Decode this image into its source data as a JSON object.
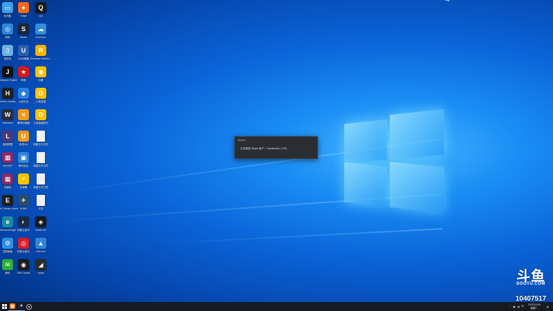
{
  "desktop": {
    "icons": [
      {
        "label": "此电脑",
        "color": "#3aa0e8",
        "glyph": "▭"
      },
      {
        "label": "Origin",
        "color": "#f06a1c",
        "glyph": "●"
      },
      {
        "label": "QQ",
        "color": "#1a1a1a",
        "glyph": "Q"
      },
      {
        "label": "网络",
        "color": "#2f86d6",
        "glyph": "◎"
      },
      {
        "label": "Steam",
        "color": "#1b2838",
        "glyph": "S"
      },
      {
        "label": "OneDrive",
        "color": "#2f8fe0",
        "glyph": "☁"
      },
      {
        "label": "回收站",
        "color": "#6ab0e6",
        "glyph": "▯"
      },
      {
        "label": "UU加速器",
        "color": "#2a5fb0",
        "glyph": "U"
      },
      {
        "label": "Rockstar Games Launcher",
        "color": "#f2b400",
        "glyph": "R"
      },
      {
        "label": "Wallpaper Engine",
        "color": "#111111",
        "glyph": "J"
      },
      {
        "label": "网易",
        "color": "#d11a1a",
        "glyph": "★"
      },
      {
        "label": "迅雷",
        "color": "#f2c200",
        "glyph": "◉"
      },
      {
        "label": "Heroic Games",
        "color": "#1f1f1f",
        "glyph": "H"
      },
      {
        "label": "火绒安全",
        "color": "#2a7fe0",
        "glyph": "◆"
      },
      {
        "label": "斗鱼直播",
        "color": "#f5c400",
        "glyph": "D"
      },
      {
        "label": "WeGame",
        "color": "#2b2b3a",
        "glyph": "W"
      },
      {
        "label": "雷神加速器",
        "color": "#f29a1a",
        "glyph": "✕"
      },
      {
        "label": "斗鱼直播伴侣",
        "color": "#f5c400",
        "glyph": "D"
      },
      {
        "label": "英雄联盟",
        "color": "#4b3a7a",
        "glyph": "L"
      },
      {
        "label": "网易UU",
        "color": "#f29a1a",
        "glyph": "U"
      },
      {
        "label": "新建文本文档",
        "color": "#f0f0f0",
        "glyph": ""
      },
      {
        "label": "WinRAR",
        "color": "#8a2a6a",
        "glyph": "▦"
      },
      {
        "label": "腾讯会议",
        "color": "#2f86d6",
        "glyph": "▣"
      },
      {
        "label": "新建文本文档",
        "color": "#f0f0f0",
        "glyph": ""
      },
      {
        "label": "压缩包",
        "color": "#8a2a6a",
        "glyph": "▦"
      },
      {
        "label": "加速器",
        "color": "#f5c400",
        "glyph": "⚡"
      },
      {
        "label": "新建文本文档",
        "color": "#f0f0f0",
        "glyph": ""
      },
      {
        "label": "Epic Games Launcher",
        "color": "#1f1f1f",
        "glyph": "E"
      },
      {
        "label": "PUBG",
        "color": "#2a4a6a",
        "glyph": "✈"
      },
      {
        "label": "文档",
        "color": "#f0f0f0",
        "glyph": ""
      },
      {
        "label": "Microsoft Edge",
        "color": "#1a8a9e",
        "glyph": "e"
      },
      {
        "label": "网易云音乐",
        "color": "#1a2a4a",
        "glyph": "◐"
      },
      {
        "label": "Battle.net",
        "color": "#1a1a1a",
        "glyph": "◈"
      },
      {
        "label": "控制面板",
        "color": "#2f8fe0",
        "glyph": "⚙"
      },
      {
        "label": "网易云音乐",
        "color": "#d81e2c",
        "glyph": "◎"
      },
      {
        "label": "GeForce",
        "color": "#2f86d6",
        "glyph": "▲"
      },
      {
        "label": "微信",
        "color": "#2aae3a",
        "glyph": "✉"
      },
      {
        "label": "OBS Studio",
        "color": "#1a1a1a",
        "glyph": "◉"
      },
      {
        "label": "Uplay",
        "color": "#2b2b2b",
        "glyph": "◢"
      }
    ]
  },
  "dialog": {
    "title": "Steam",
    "message": "正在登录 Steam 帐户：Yozhabomb_1745..."
  },
  "watermark": {
    "mark": "斗鱼",
    "brand": "DOUYU.COM",
    "room": "10407517"
  },
  "taskbar": {
    "clock_time": "2022/11/26",
    "clock_date": "星期一",
    "ime": "中"
  }
}
